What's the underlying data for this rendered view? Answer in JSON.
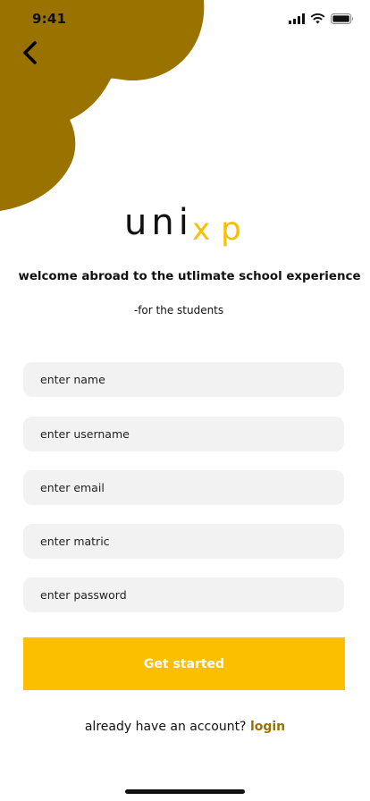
{
  "colors": {
    "blob": "#9a7200",
    "accent": "#fbbf00",
    "link": "#9a7200",
    "field_bg": "#f2f2f2",
    "text": "#111111"
  },
  "status_bar": {
    "time": "9:41",
    "icons": [
      "signal-icon",
      "wifi-icon",
      "battery-icon"
    ]
  },
  "nav": {
    "back_icon": "chevron-left-icon"
  },
  "logo": {
    "text_primary": "uni",
    "text_accent": "x",
    "text_last": "p"
  },
  "header": {
    "welcome": "welcome abroad to the utlimate school experience",
    "subtitle": "-for the students"
  },
  "form": {
    "name_placeholder": "enter name",
    "username_placeholder": "enter username",
    "email_placeholder": "enter email",
    "matric_placeholder": "enter matric",
    "password_placeholder": "enter password",
    "submit_label": "Get started"
  },
  "footer": {
    "prompt": "already have an account?",
    "login_label": "login"
  }
}
